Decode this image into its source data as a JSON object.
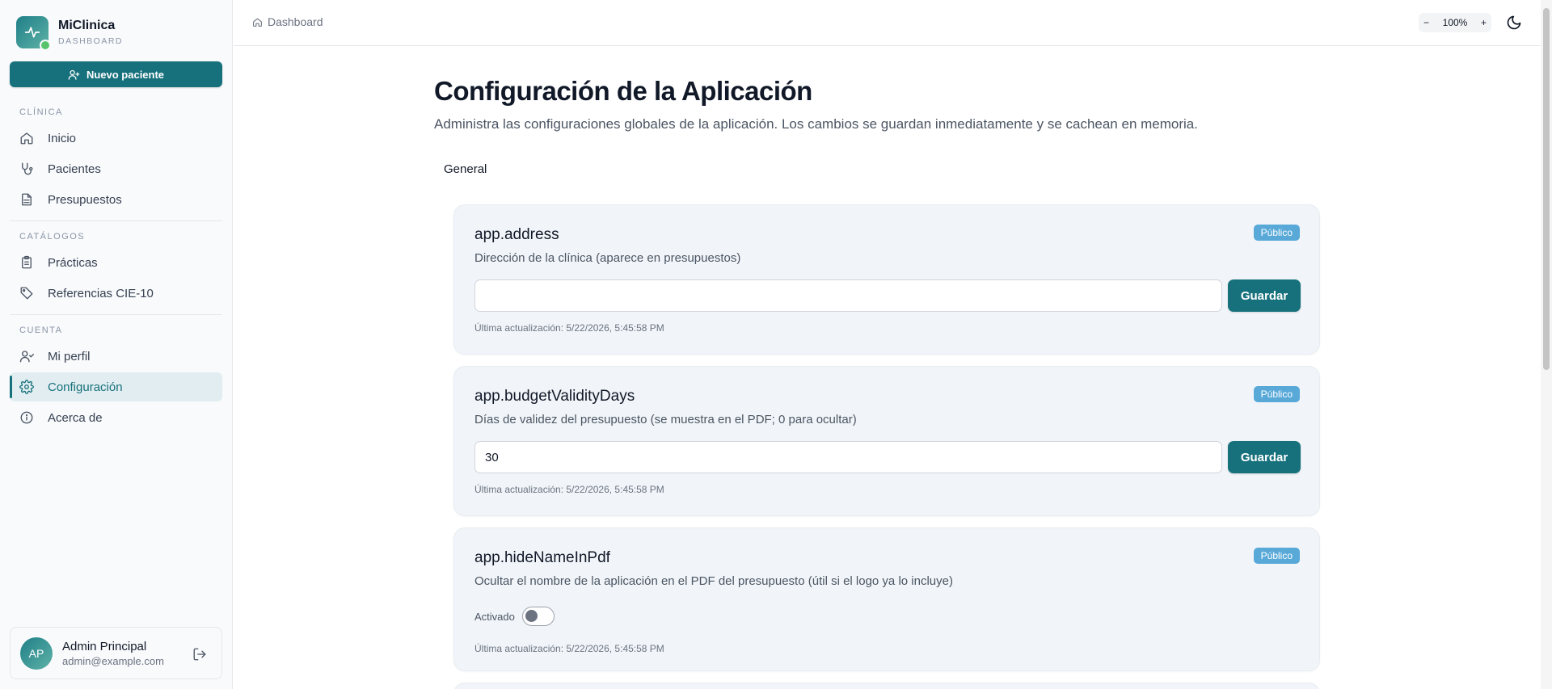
{
  "brand": {
    "name": "MiClinica",
    "subtitle": "DASHBOARD"
  },
  "sidebar": {
    "new_patient_label": "Nuevo paciente",
    "sections": [
      {
        "label": "CLÍNICA",
        "items": [
          {
            "label": "Inicio",
            "icon": "home-icon"
          },
          {
            "label": "Pacientes",
            "icon": "stethoscope-icon"
          },
          {
            "label": "Presupuestos",
            "icon": "document-icon"
          }
        ]
      },
      {
        "label": "CATÁLOGOS",
        "items": [
          {
            "label": "Prácticas",
            "icon": "clipboard-icon"
          },
          {
            "label": "Referencias CIE-10",
            "icon": "tag-icon"
          }
        ]
      },
      {
        "label": "CUENTA",
        "items": [
          {
            "label": "Mi perfil",
            "icon": "user-icon"
          },
          {
            "label": "Configuración",
            "icon": "gear-icon",
            "active": true
          },
          {
            "label": "Acerca de",
            "icon": "info-icon"
          }
        ]
      }
    ],
    "user": {
      "initials": "AP",
      "name": "Admin Principal",
      "email": "admin@example.com"
    }
  },
  "header": {
    "breadcrumb": "Dashboard",
    "zoom": {
      "minus": "−",
      "value": "100%",
      "plus": "+"
    }
  },
  "main": {
    "title": "Configuración de la Aplicación",
    "description": "Administra las configuraciones globales de la aplicación. Los cambios se guardan inmediatamente y se cachean en memoria.",
    "tab": "General",
    "settings": [
      {
        "key": "app.address",
        "badge": "Público",
        "description": "Dirección de la clínica (aparece en presupuestos)",
        "value": "",
        "save_label": "Guardar",
        "updated": "Última actualización: 5/22/2026, 5:45:58 PM"
      },
      {
        "key": "app.budgetValidityDays",
        "badge": "Público",
        "description": "Días de validez del presupuesto (se muestra en el PDF; 0 para ocultar)",
        "value": "30",
        "save_label": "Guardar",
        "updated": "Última actualización: 5/22/2026, 5:45:58 PM"
      },
      {
        "key": "app.hideNameInPdf",
        "badge": "Público",
        "description": "Ocultar el nombre de la aplicación en el PDF del presupuesto (útil si el logo ya lo incluye)",
        "toggle_label": "Activado",
        "toggle_on": false,
        "updated": "Última actualización: 5/22/2026, 5:45:58 PM"
      }
    ]
  }
}
